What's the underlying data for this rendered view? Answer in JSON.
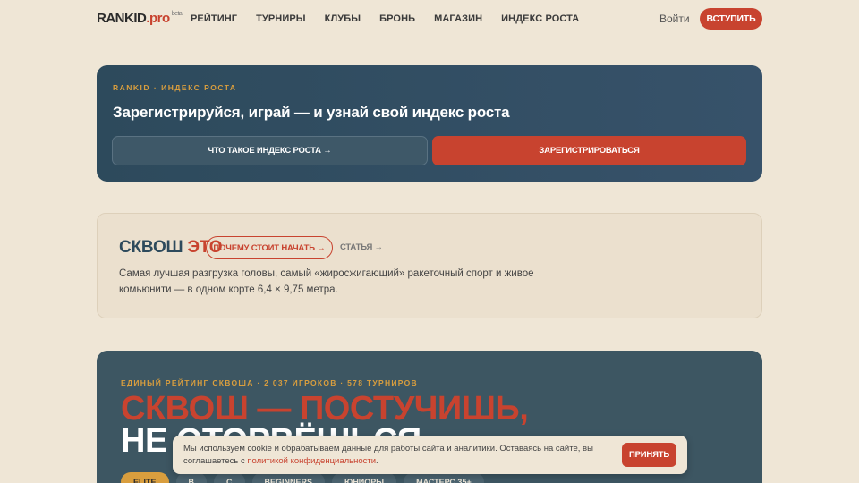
{
  "header": {
    "logo_main": "RANKID",
    "logo_pro": ".pro",
    "logo_beta": "beta",
    "nav": [
      "РЕЙТИНГ",
      "ТУРНИРЫ",
      "КЛУБЫ",
      "БРОНЬ",
      "МАГАЗИН",
      "ИНДЕКС РОСТА"
    ],
    "login": "Войти",
    "join": "ВСТУПИТЬ"
  },
  "hero": {
    "eyebrow": "RANKID · ИНДЕКС РОСТА",
    "headline": "Зарегистрируйся, играй — и узнай свой индекс роста",
    "secondary_button": "ЧТО ТАКОЕ ИНДЕКС РОСТА →",
    "primary_button": "ЗАРЕГИСТРИРОВАТЬСЯ"
  },
  "squash": {
    "title_a": "СКВОШ",
    "title_b": "ЭТО",
    "pill": "ПОЧЕМУ СТОИТ НАЧАТЬ →",
    "article": "СТАТЬЯ →",
    "description": "Самая лучшая разгрузка головы, самый «жиросжигающий» ракеточный спорт и живое комьюнити — в одном корте 6,4 × 9,75 метра."
  },
  "rating": {
    "eyebrow": "ЕДИНЫЙ РЕЙТИНГ СКВОША · 2 037 ИГРОКОВ · 578 ТУРНИРОВ",
    "line1": "СКВОШ — ПОСТУЧИШЬ,",
    "line2": "НЕ ОТОРВЁШЬСЯ",
    "chips": [
      "ELITE",
      "B",
      "C",
      "BEGINNERS",
      "ЮНИОРЫ",
      "МАСТЕРС 35+"
    ]
  },
  "cookie": {
    "text_before": "Мы используем cookie и обрабатываем данные для работы сайта и аналитики. Оставаясь на сайте, вы соглашаетесь с ",
    "link": "политикой конфиденциальности",
    "text_after": ".",
    "accept": "ПРИНЯТЬ"
  },
  "colors": {
    "accent": "#c8432f",
    "gold": "#d99e3e",
    "navy": "#2d4a5c",
    "background": "#efe6d6"
  }
}
